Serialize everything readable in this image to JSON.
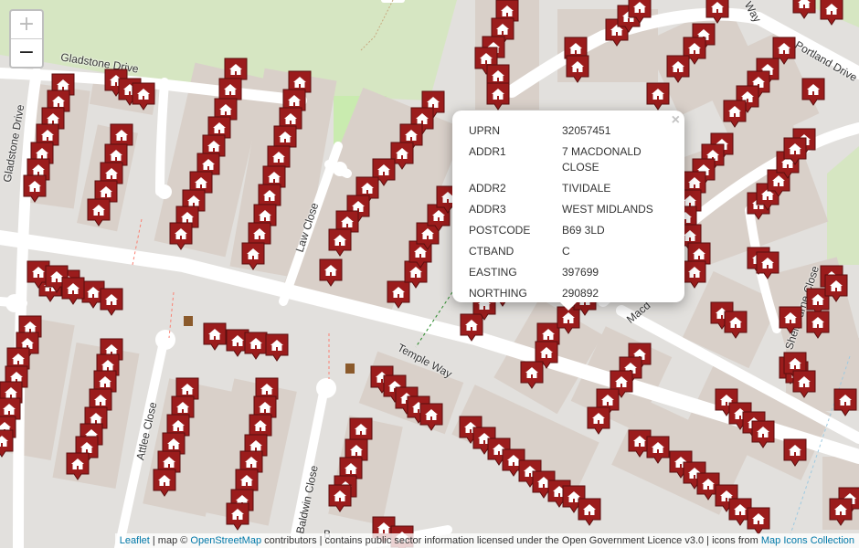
{
  "zoom": {
    "in_label": "+",
    "out_label": "−"
  },
  "roads": [
    {
      "id": "gladstone-drive-top",
      "name": "Gladstone Drive"
    },
    {
      "id": "gladstone-drive-side",
      "name": "Gladstone Drive"
    },
    {
      "id": "law-close",
      "name": "Law Close"
    },
    {
      "id": "temple-way",
      "name": "Temple Way"
    },
    {
      "id": "attlee-close",
      "name": "Attlee Close"
    },
    {
      "id": "baldwin-close",
      "name": "Baldwin Close"
    },
    {
      "id": "shelbourne-close",
      "name": "Shelbourne Close"
    },
    {
      "id": "portland-drive",
      "name": "Portland Drive"
    },
    {
      "id": "macdonald-close",
      "name": "Macd"
    },
    {
      "id": "top-way",
      "name": "Way"
    },
    {
      "id": "bottom-b",
      "name": "B"
    }
  ],
  "popup": {
    "close_symbol": "×",
    "rows": [
      {
        "key": "UPRN",
        "value": "32057451"
      },
      {
        "key": "ADDR1",
        "value": "7 MACDONALD CLOSE"
      },
      {
        "key": "ADDR2",
        "value": "TIVIDALE"
      },
      {
        "key": "ADDR3",
        "value": "WEST MIDLANDS"
      },
      {
        "key": "POSTCODE",
        "value": "B69 3LD"
      },
      {
        "key": "CTBAND",
        "value": "C"
      },
      {
        "key": "EASTING",
        "value": "397699"
      },
      {
        "key": "NORTHING",
        "value": "290892"
      }
    ]
  },
  "attribution": {
    "leaflet": "Leaflet",
    "sep1": " | map © ",
    "osm": "OpenStreetMap",
    "mid": " contributors | contains public sector information licensed under the Open Government Licence v3.0 | icons from ",
    "icons": "Map Icons Collection"
  },
  "colors": {
    "marker": "#9b1c1c",
    "marker_border": "#5a0e0e",
    "park": "#d6e6c2",
    "grass": "#c9ebaf",
    "road": "#ffffff",
    "building": "#d9d0c9"
  },
  "marker_icon": "house-marker-icon"
}
